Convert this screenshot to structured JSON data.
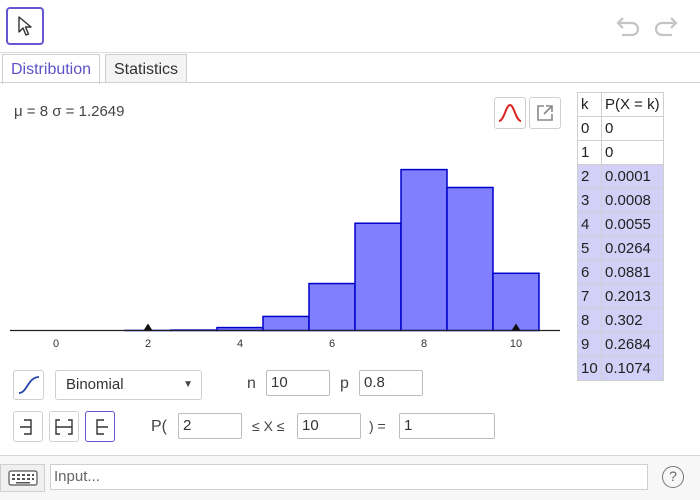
{
  "toolbar": {
    "move_tool": "arrow-cursor-icon",
    "undo": "undo-icon",
    "redo": "redo-icon"
  },
  "tabs": [
    {
      "label": "Distribution",
      "active": true
    },
    {
      "label": "Statistics",
      "active": false
    }
  ],
  "stats": {
    "summary": "μ = 8 σ = 1.2649"
  },
  "icons": {
    "normal_overlay": "bell-curve-icon",
    "export": "export-icon",
    "cumulative": "cumulative-curve-icon",
    "keyboard": "keyboard-icon",
    "help": "?"
  },
  "colors": {
    "bar_fill": "#8080ff",
    "bar_stroke": "#0000cc",
    "accent": "#6557d2",
    "highlight": "#d3d0f7"
  },
  "table": {
    "headers": [
      "k",
      "P(X = k)"
    ],
    "rows": [
      {
        "k": "0",
        "p": "0",
        "hl": false
      },
      {
        "k": "1",
        "p": "0",
        "hl": false
      },
      {
        "k": "2",
        "p": "0.0001",
        "hl": true
      },
      {
        "k": "3",
        "p": "0.0008",
        "hl": true
      },
      {
        "k": "4",
        "p": "0.0055",
        "hl": true
      },
      {
        "k": "5",
        "p": "0.0264",
        "hl": true
      },
      {
        "k": "6",
        "p": "0.0881",
        "hl": true
      },
      {
        "k": "7",
        "p": "0.2013",
        "hl": true
      },
      {
        "k": "8",
        "p": "0.302",
        "hl": true
      },
      {
        "k": "9",
        "p": "0.2684",
        "hl": true
      },
      {
        "k": "10",
        "p": "0.1074",
        "hl": true
      }
    ]
  },
  "controls": {
    "distribution": "Binomial",
    "n_label": "n",
    "n_value": "10",
    "p_label": "p",
    "p_value": "0.8",
    "prob_prefix": "P(",
    "lower": "2",
    "between": "≤ X ≤",
    "upper": "10",
    "equals": ") =",
    "result": "1"
  },
  "input_bar": {
    "placeholder": "Input..."
  },
  "chart_data": {
    "type": "bar",
    "categories": [
      0,
      1,
      2,
      3,
      4,
      5,
      6,
      7,
      8,
      9,
      10
    ],
    "values": [
      0,
      0,
      0.0001,
      0.0008,
      0.0055,
      0.0264,
      0.0881,
      0.2013,
      0.302,
      0.2684,
      0.1074
    ],
    "xticks": [
      "0",
      "2",
      "4",
      "6",
      "8",
      "10"
    ],
    "xlim": [
      -0.6,
      10.6
    ],
    "ylim": [
      0,
      0.32
    ],
    "markers": [
      2,
      10
    ],
    "grid": false
  }
}
